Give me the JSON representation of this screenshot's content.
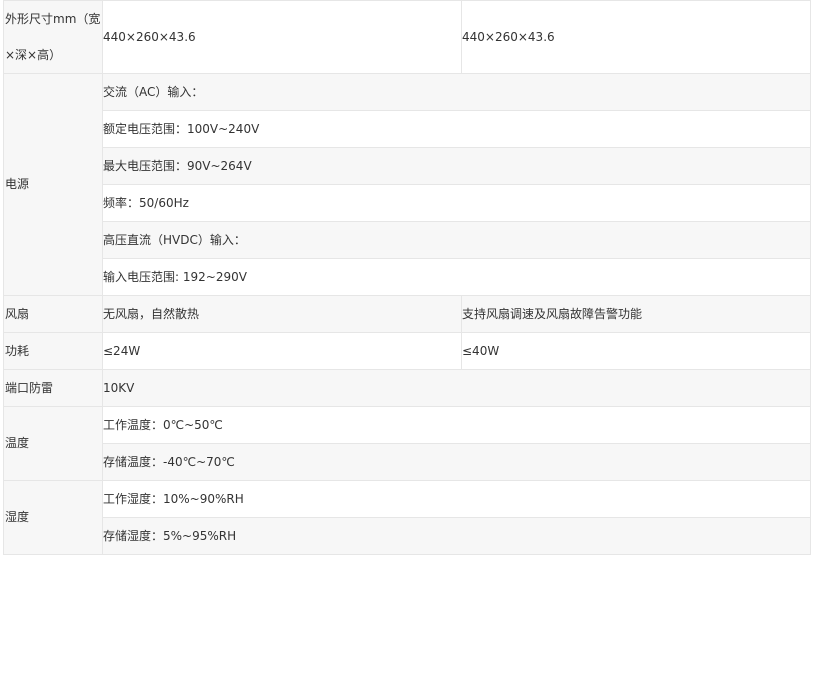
{
  "rows": {
    "dimensions": {
      "label": "外形尺寸mm（宽×深×高）",
      "value_a": "440×260×43.6",
      "value_b": "440×260×43.6"
    },
    "power": {
      "label": "电源",
      "lines": [
        "交流（AC）输入：",
        "额定电压范围：100V~240V",
        "最大电压范围：90V~264V",
        "频率：50/60Hz",
        "高压直流（HVDC）输入：",
        "输入电压范围: 192~290V"
      ]
    },
    "fan": {
      "label": "风扇",
      "value_a": "无风扇，自然散热",
      "value_b": "支持风扇调速及风扇故障告警功能"
    },
    "consumption": {
      "label": "功耗",
      "value_a": "≤24W",
      "value_b": "≤40W"
    },
    "surge": {
      "label": "端口防雷",
      "value": "10KV"
    },
    "temperature": {
      "label": "温度",
      "lines": [
        "工作温度：0℃~50℃",
        "存储温度：-40℃~70℃"
      ]
    },
    "humidity": {
      "label": "湿度",
      "lines": [
        "工作湿度：10%~90%RH",
        "存储湿度：5%~95%RH"
      ]
    }
  }
}
